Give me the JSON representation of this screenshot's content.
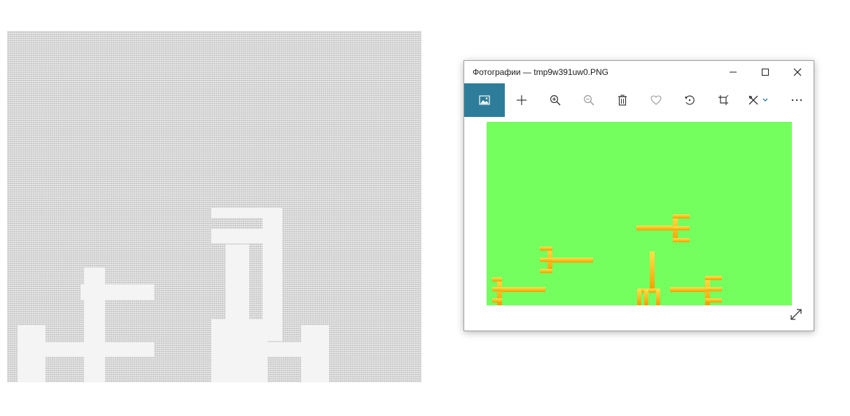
{
  "window": {
    "title": "Фотографии — tmp9w391uw0.PNG"
  },
  "titlebar": {
    "minimize_icon": "minimize-icon",
    "maximize_icon": "maximize-icon",
    "close_icon": "close-icon"
  },
  "toolbar": {
    "items": [
      {
        "icon": "image-view-icon"
      },
      {
        "icon": "add-icon"
      },
      {
        "icon": "zoom-in-icon"
      },
      {
        "icon": "zoom-out-icon"
      },
      {
        "icon": "delete-icon"
      },
      {
        "icon": "favorite-heart-icon"
      },
      {
        "icon": "rotate-icon"
      },
      {
        "icon": "crop-icon"
      },
      {
        "icon": "edit-draw-icon"
      },
      {
        "icon": "more-icon"
      }
    ]
  },
  "image": {
    "background": "#75ff5f",
    "fork_color": "#ffc21a"
  },
  "colors": {
    "accent": "#2d7d9a",
    "ascii_bg": "#c9c9c9"
  }
}
